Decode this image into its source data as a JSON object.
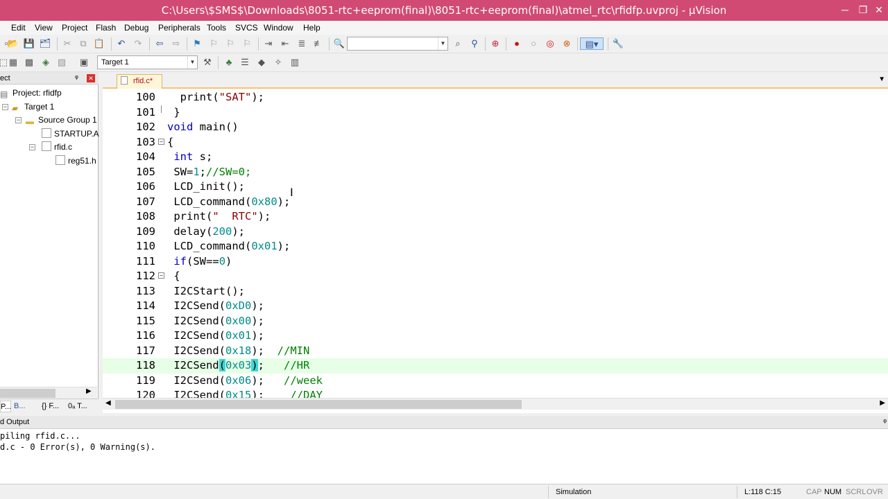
{
  "window": {
    "title": "C:\\Users\\$SMS$\\Downloads\\8051-rtc+eeprom(final)\\8051-rtc+eeprom(final)\\atmel_rtc\\rfidfp.uvproj - µVision",
    "minimize": "─",
    "maximize": "❐",
    "close": "✕"
  },
  "menu": [
    "Edit",
    "View",
    "Project",
    "Flash",
    "Debug",
    "Peripherals",
    "Tools",
    "SVCS",
    "Window",
    "Help"
  ],
  "toolbar2": {
    "target_select": "Target 1"
  },
  "project_panel": {
    "header": "ect",
    "pin": "ᵠ",
    "close": "✕",
    "tree": {
      "project": "Project: rfidfp",
      "target": "Target 1",
      "group": "Source Group 1",
      "startup": "STARTUP.A",
      "rfid": "rfid.c",
      "reg51": "reg51.h"
    },
    "tabs": [
      "P...",
      "B...",
      "{} F...",
      "0ₐ T..."
    ]
  },
  "editor": {
    "tab_label": "rfid.c*",
    "lines": [
      {
        "n": "100",
        "code": "  print(\"SAT\");"
      },
      {
        "n": "101",
        "code": " }"
      },
      {
        "n": "102",
        "code": "void main()"
      },
      {
        "n": "103",
        "code": "{"
      },
      {
        "n": "104",
        "code": " int s;"
      },
      {
        "n": "105",
        "code": " SW=1;//SW=0;"
      },
      {
        "n": "106",
        "code": " LCD_init();"
      },
      {
        "n": "107",
        "code": " LCD_command(0x80);"
      },
      {
        "n": "108",
        "code": " print(\"  RTC\");"
      },
      {
        "n": "109",
        "code": " delay(200);"
      },
      {
        "n": "110",
        "code": " LCD_command(0x01);"
      },
      {
        "n": "111",
        "code": " if(SW==0)"
      },
      {
        "n": "112",
        "code": " {"
      },
      {
        "n": "113",
        "code": " I2CStart();"
      },
      {
        "n": "114",
        "code": " I2CSend(0xD0);"
      },
      {
        "n": "115",
        "code": " I2CSend(0x00);"
      },
      {
        "n": "116",
        "code": " I2CSend(0x01);"
      },
      {
        "n": "117",
        "code": " I2CSend(0x18);  //MIN"
      },
      {
        "n": "118",
        "code": " I2CSend(0x03);   //HR"
      },
      {
        "n": "119",
        "code": " I2CSend(0x06);   //week"
      },
      {
        "n": "120",
        "code": " I2CSend(0x15);    //DAY"
      }
    ]
  },
  "build_output": {
    "header": "d Output",
    "pin": "ᵠ",
    "lines": [
      "piling rfid.c...",
      "d.c - 0 Error(s), 0 Warning(s)."
    ]
  },
  "status": {
    "mode": "Simulation",
    "cursor": "L:118 C:15",
    "cap": "CAP",
    "num": "NUM",
    "scrl": "SCRL",
    "ovr": "OVR"
  },
  "colors": {
    "title_bar": "#d14a74",
    "keyword": "#0000c0",
    "number": "#008b8b",
    "comment": "#008000",
    "string": "#8b0000",
    "current_line": "#e6ffe6",
    "brace_match": "#3fd6d6"
  }
}
